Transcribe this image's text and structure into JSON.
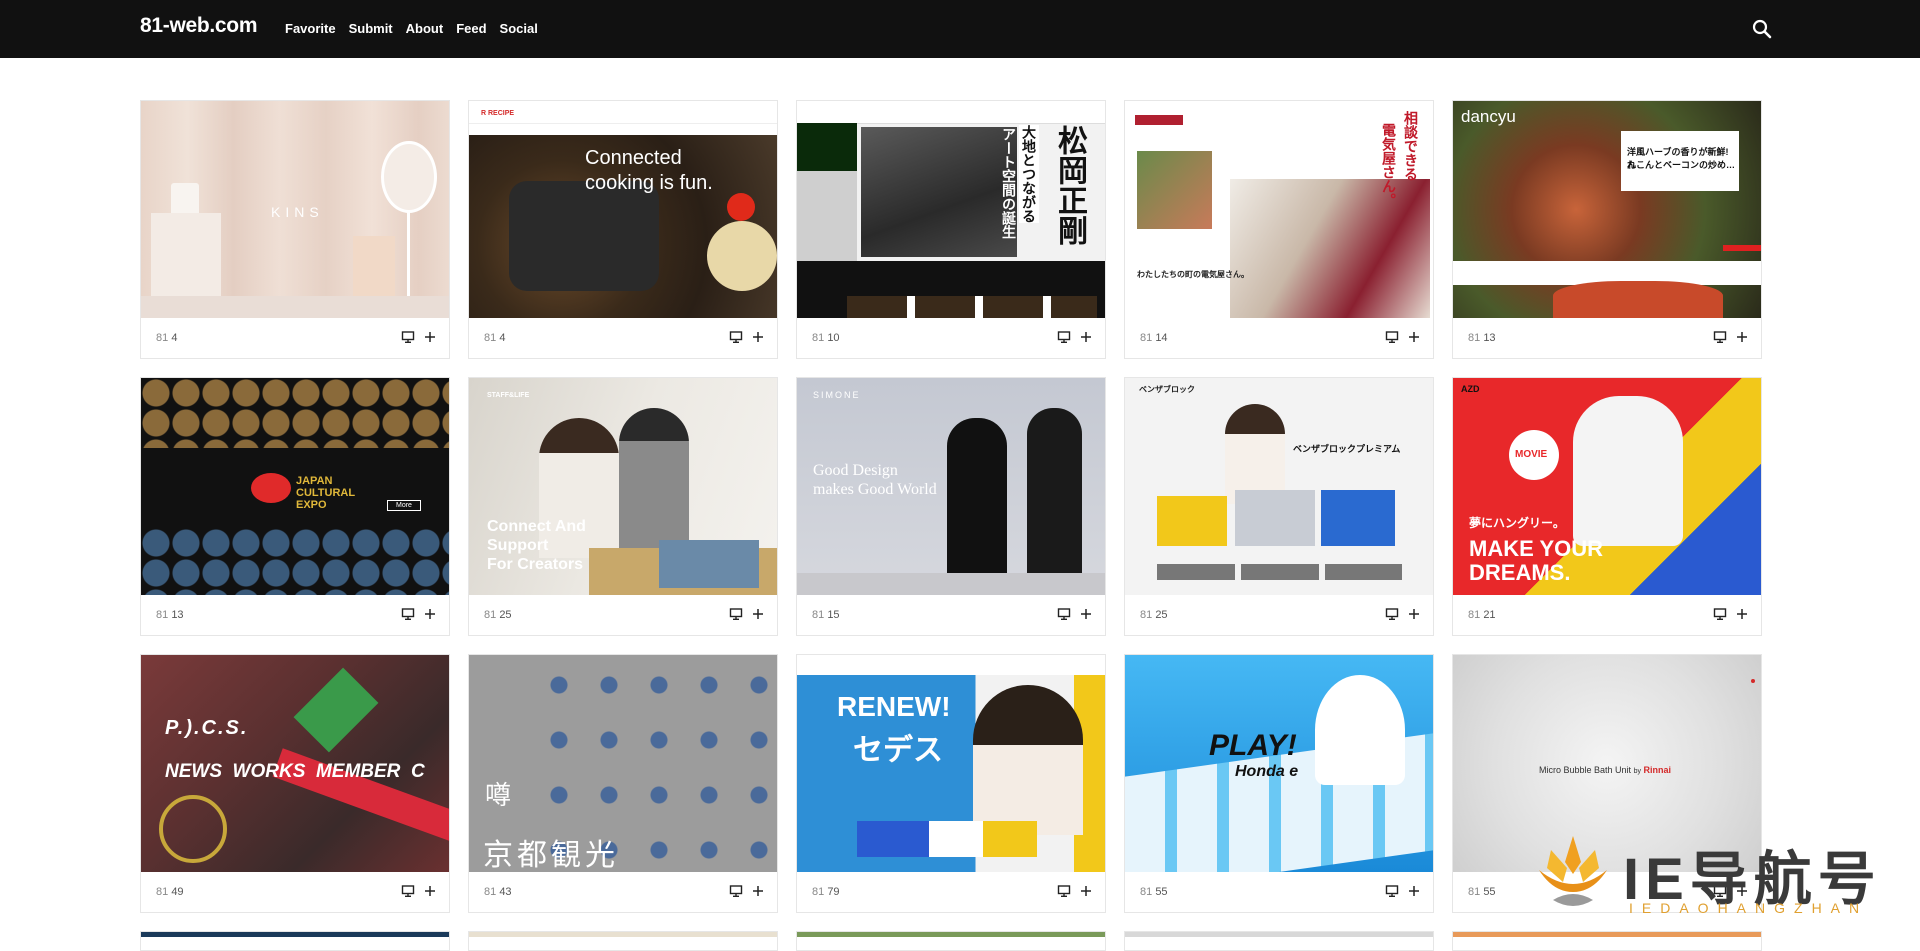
{
  "header": {
    "logo": "81-web.com",
    "nav": [
      "Favorite",
      "Submit",
      "About",
      "Feed",
      "Social"
    ]
  },
  "cards": [
    {
      "label": "81",
      "count": "4",
      "thumb": {
        "bg": "#e8d6cc",
        "text": "KINS"
      }
    },
    {
      "label": "81",
      "count": "4",
      "thumb": {
        "bg": "#5a4a3a",
        "header": "R RECIPE",
        "text1": "Connected",
        "text2": "cooking is fun."
      }
    },
    {
      "label": "81",
      "count": "10",
      "thumb": {
        "bg": "#f2f2f2",
        "text1": "松岡正剛",
        "text2": "大地とつながる",
        "text3": "アート空間の誕生"
      }
    },
    {
      "label": "81",
      "count": "14",
      "thumb": {
        "bg": "#ffffff",
        "text1": "相談できる",
        "text2": "電気屋さん。",
        "text3": "わたしたちの町の電気屋さん。"
      }
    },
    {
      "label": "81",
      "count": "13",
      "thumb": {
        "bg": "#7a5a40",
        "logo": "dancyu",
        "text1": "洋風ハーブの香りが新鮮!れ",
        "text2": "んこんとベーコンの炒め…"
      }
    },
    {
      "label": "81",
      "count": "13",
      "thumb": {
        "bg": "#111111",
        "text1": "JAPAN",
        "text2": "CULTURAL",
        "text3": "EXPO",
        "btn": "More"
      }
    },
    {
      "label": "81",
      "count": "25",
      "thumb": {
        "bg": "#e9e6e1",
        "header": "STAFF&LIFE",
        "text1": "Connect And",
        "text2": "Support",
        "text3": "For Creators"
      }
    },
    {
      "label": "81",
      "count": "15",
      "thumb": {
        "bg": "#c9ccd4",
        "header": "SIMONE",
        "text1": "Good Design",
        "text2": "makes Good World"
      }
    },
    {
      "label": "81",
      "count": "25",
      "thumb": {
        "bg": "#f3f3f3",
        "header": "ベンザブロック",
        "text1": "ベンザブロックプレミアム"
      }
    },
    {
      "label": "81",
      "count": "21",
      "thumb": {
        "bg": "#e8282a",
        "header": "AZD",
        "text1": "夢にハングリー。",
        "text2": "MAKE YOUR",
        "text3": "DREAMS.",
        "badge": "MOVIE"
      }
    },
    {
      "label": "81",
      "count": "49",
      "thumb": {
        "bg": "#8a3a3a",
        "text1": "P.).C.S.",
        "text2": "NEWS  WORKS  MEMBER  C"
      }
    },
    {
      "label": "81",
      "count": "43",
      "thumb": {
        "bg": "#9a9a9a",
        "text1": "噂",
        "text2": "京都観光"
      }
    },
    {
      "label": "81",
      "count": "79",
      "thumb": {
        "bg": "#2e8fd6",
        "text1": "RENEW!",
        "text2": "セデス"
      }
    },
    {
      "label": "81",
      "count": "55",
      "thumb": {
        "bg": "#3ab0f0",
        "text1": "PLAY!",
        "text2": "Honda e"
      }
    },
    {
      "label": "81",
      "count": "55",
      "thumb": {
        "bg": "#e2e2e2",
        "text1": "Micro Bubble Bath Unit",
        "text2": "by",
        "text3": "Rinnai"
      }
    }
  ],
  "watermark": {
    "main": "IE导航号",
    "sub": "IEDAOHANGZHAN"
  },
  "colors": {
    "topbar": "#111111",
    "accent": "#e8282a"
  }
}
